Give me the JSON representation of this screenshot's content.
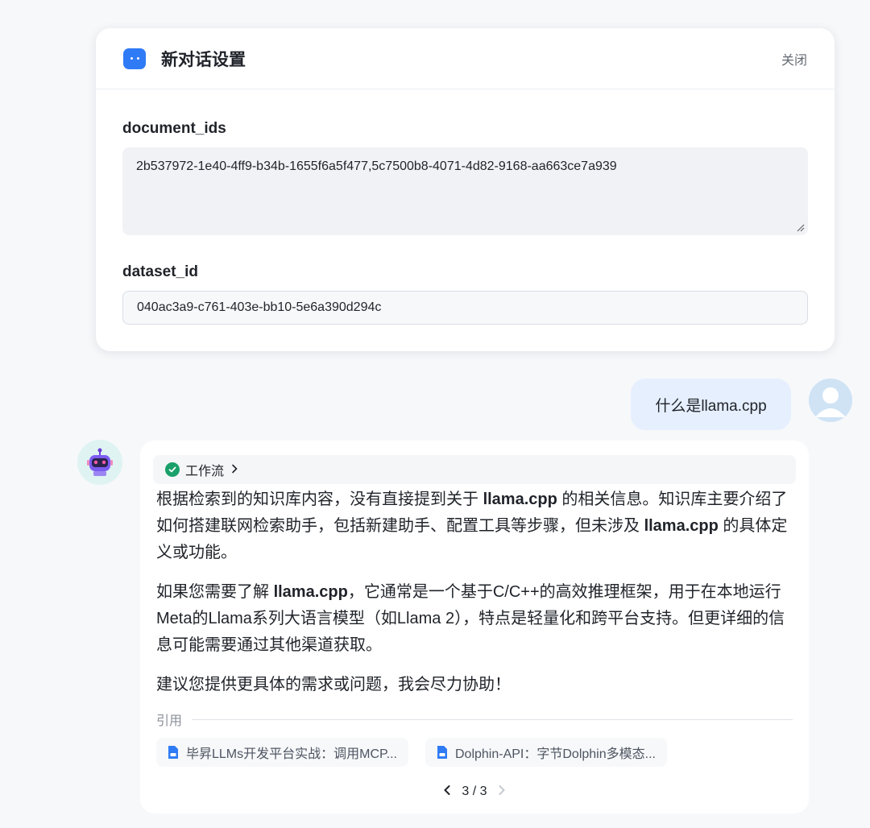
{
  "settings": {
    "title": "新对话设置",
    "close_label": "关闭",
    "fields": [
      {
        "label": "document_ids",
        "value": "2b537972-1e40-4ff9-b34b-1655f6a5f477,5c7500b8-4071-4d82-9168-aa663ce7a939"
      },
      {
        "label": "dataset_id",
        "value": "040ac3a9-c761-403e-bb10-5e6a390d294c"
      }
    ]
  },
  "user_message": {
    "text": "什么是llama.cpp"
  },
  "bot_message": {
    "workflow_label": "工作流",
    "paragraphs": [
      [
        "根据检索到的知识库内容，没有直接提到关于 ",
        "llama.cpp",
        " 的相关信息。知识库主要介绍了如何搭建联网检索助手，包括新建助手、配置工具等步骤，但未涉及 ",
        "llama.cpp",
        " 的具体定义或功能。"
      ],
      [
        "如果您需要了解 ",
        "llama.cpp",
        "，它通常是一个基于C/C++的高效推理框架，用于在本地运行Meta的Llama系列大语言模型（如Llama 2），特点是轻量化和跨平台支持。但更详细的信息可能需要通过其他渠道获取。"
      ],
      [
        "建议您提供更具体的需求或问题，我会尽力协助！"
      ]
    ],
    "references_label": "引用",
    "references": [
      {
        "title": "毕昇LLMs开发平台实战：调用MCP..."
      },
      {
        "title": "Dolphin-API：字节Dolphin多模态..."
      }
    ],
    "pager": {
      "current": "3",
      "separator": "/",
      "total": "3"
    }
  },
  "colors": {
    "accent": "#2f7bf6",
    "success": "#1aa06a",
    "user_bubble": "#e6effd"
  },
  "icons": [
    "chat-icon",
    "check-icon",
    "chevron-right-icon",
    "document-icon",
    "chevron-left-icon",
    "user-avatar-icon",
    "robot-avatar-icon"
  ]
}
